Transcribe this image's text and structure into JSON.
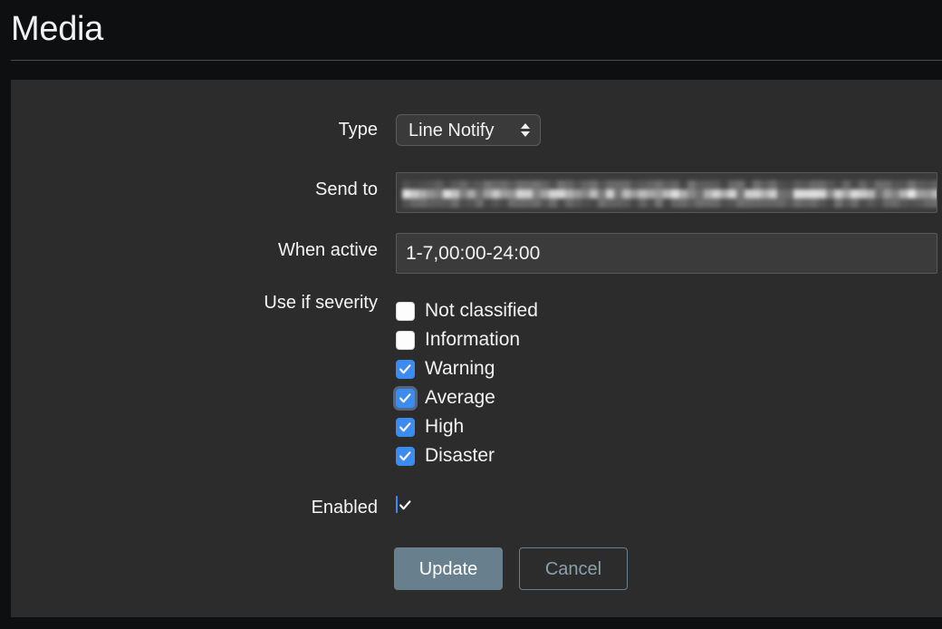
{
  "header": {
    "title": "Media"
  },
  "form": {
    "type": {
      "label": "Type",
      "value": "Line Notify",
      "options": [
        "Line Notify"
      ]
    },
    "send_to": {
      "label": "Send to",
      "value": "",
      "placeholder": "",
      "redacted": true
    },
    "when_active": {
      "label": "When active",
      "value": "1-7,00:00-24:00",
      "placeholder": ""
    },
    "severity": {
      "label": "Use if severity",
      "items": [
        {
          "label": "Not classified",
          "checked": false,
          "focused": false
        },
        {
          "label": "Information",
          "checked": false,
          "focused": false
        },
        {
          "label": "Warning",
          "checked": true,
          "focused": false
        },
        {
          "label": "Average",
          "checked": true,
          "focused": true
        },
        {
          "label": "High",
          "checked": true,
          "focused": false
        },
        {
          "label": "Disaster",
          "checked": true,
          "focused": false
        }
      ]
    },
    "enabled": {
      "label": "Enabled",
      "checked": true
    }
  },
  "buttons": {
    "update_label": "Update",
    "cancel_label": "Cancel"
  },
  "colors": {
    "page_background": "#0d0f11",
    "panel_background": "#2c2c2c",
    "input_background": "#3b3b3b",
    "input_border": "#585858",
    "text": "#f2f2f2",
    "checkbox_checked": "#3b8bf0",
    "primary_button": "#68808d",
    "secondary_button_text": "#8ba0ab",
    "divider": "#4a4d50"
  }
}
